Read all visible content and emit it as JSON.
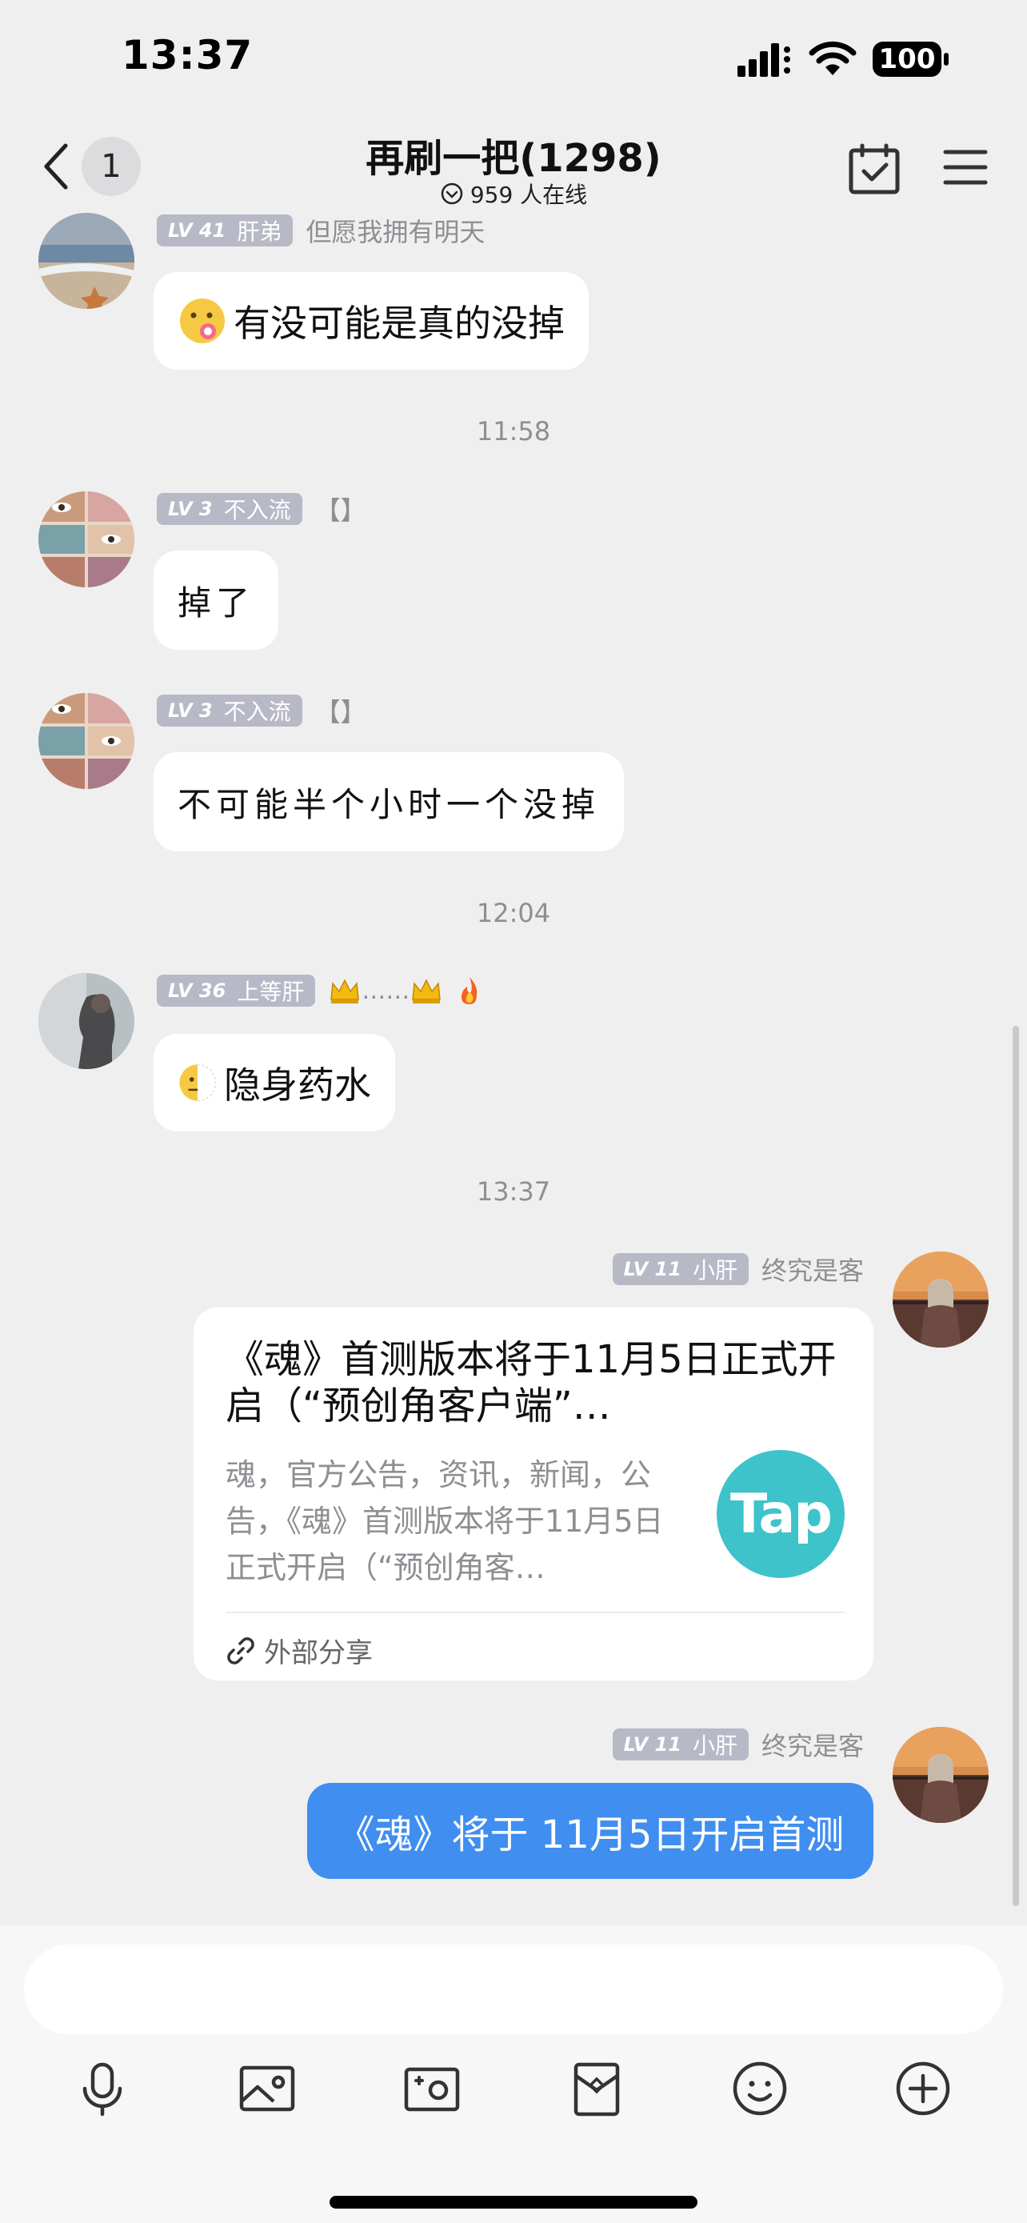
{
  "status_bar": {
    "time": "13:37",
    "battery": "100"
  },
  "nav": {
    "back_count": "1",
    "title": "再刷一把(1298)",
    "online": "959 人在线"
  },
  "messages": [
    {
      "level": "LV 41",
      "title": "肝弟",
      "signature": "但愿我拥有明天",
      "text": "有没可能是真的没掉"
    },
    {
      "time": "11:58"
    },
    {
      "level": "LV 3",
      "title": "不入流",
      "signature": "【】",
      "text": "掉了"
    },
    {
      "level": "LV 3",
      "title": "不入流",
      "signature": "【】",
      "text": "不可能半个小时一个没掉"
    },
    {
      "time": "12:04"
    },
    {
      "level": "LV 36",
      "title": "上等肝",
      "signature": "……",
      "text": "隐身药水"
    },
    {
      "time": "13:37"
    },
    {
      "level": "LV 11",
      "title": "小肝",
      "signature": "终究是客",
      "card": {
        "title": "《魂》首测版本将于11月5日正式开启（“预创角客户端”…",
        "desc": "魂，官方公告，资讯，新闻，公告，《魂》首测版本将于11月5日正式开启（“预创角客…",
        "logo_text": "Tap",
        "footer": "外部分享"
      }
    },
    {
      "level": "LV 11",
      "title": "小肝",
      "signature": "终究是客",
      "text": "《魂》将于 11月5日开启首测"
    }
  ],
  "input": {
    "placeholder": ""
  },
  "toolbar": [
    "microphone-icon",
    "image-icon",
    "camera-icon",
    "red-packet-icon",
    "emoji-icon",
    "plus-icon"
  ],
  "colors": {
    "accent": "#3f8ef0",
    "badge": "#b8b9c6",
    "background": "#efefef",
    "tap_logo": "#3dc3c9"
  }
}
